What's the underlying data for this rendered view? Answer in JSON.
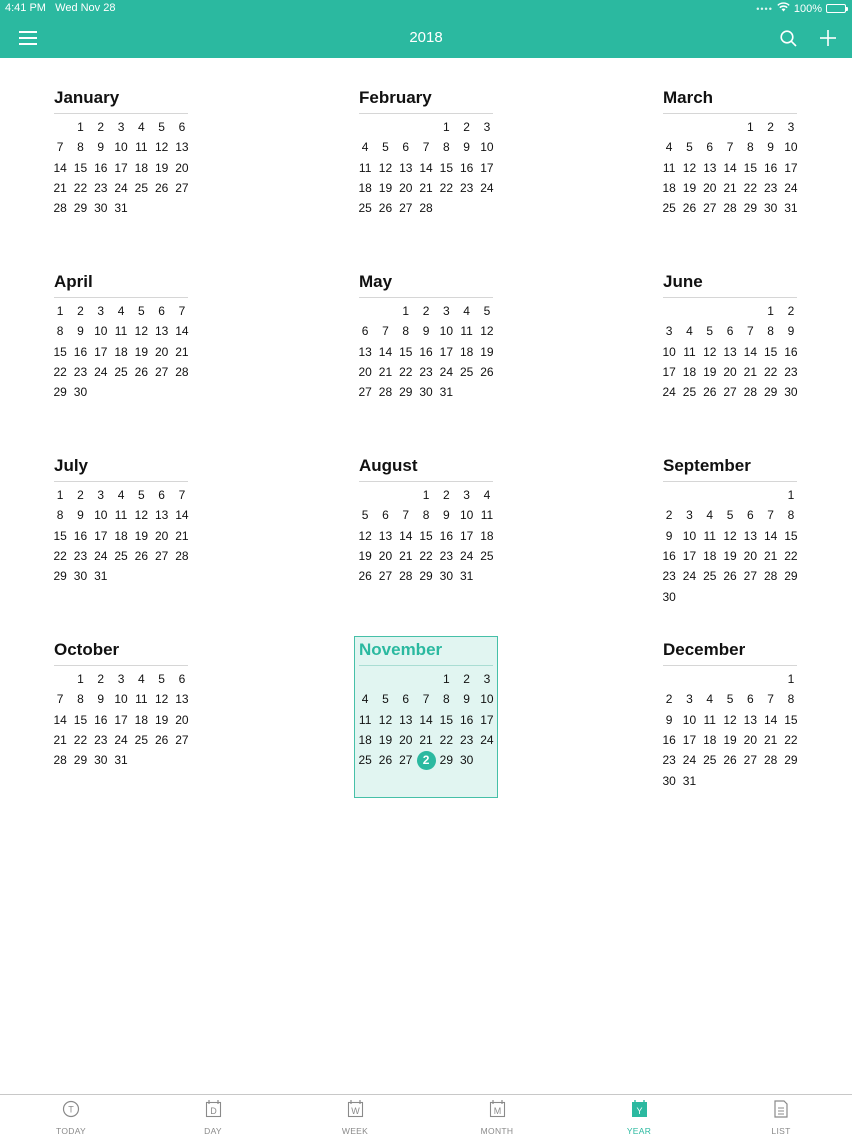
{
  "status": {
    "time": "4:41 PM",
    "date": "Wed Nov 28",
    "battery": "100%"
  },
  "header": {
    "title": "2018"
  },
  "colors": {
    "accent": "#2bb9a0",
    "selected_bg": "#e1f5f1"
  },
  "icons": {
    "menu": "hamburger-icon",
    "search": "search-icon",
    "add": "plus-icon"
  },
  "months": [
    {
      "name": "January",
      "rows": [
        [
          "",
          "1",
          "2",
          "3",
          "4",
          "5",
          "6"
        ],
        [
          "7",
          "8",
          "9",
          "10",
          "11",
          "12",
          "13"
        ],
        [
          "14",
          "15",
          "16",
          "17",
          "18",
          "19",
          "20"
        ],
        [
          "21",
          "22",
          "23",
          "24",
          "25",
          "26",
          "27"
        ],
        [
          "28",
          "29",
          "30",
          "31",
          "",
          "",
          ""
        ]
      ]
    },
    {
      "name": "February",
      "rows": [
        [
          "",
          "",
          "",
          "",
          "1",
          "2",
          "3"
        ],
        [
          "4",
          "5",
          "6",
          "7",
          "8",
          "9",
          "10"
        ],
        [
          "11",
          "12",
          "13",
          "14",
          "15",
          "16",
          "17"
        ],
        [
          "18",
          "19",
          "20",
          "21",
          "22",
          "23",
          "24"
        ],
        [
          "25",
          "26",
          "27",
          "28",
          "",
          "",
          ""
        ]
      ]
    },
    {
      "name": "March",
      "rows": [
        [
          "",
          "",
          "",
          "",
          "1",
          "2",
          "3"
        ],
        [
          "4",
          "5",
          "6",
          "7",
          "8",
          "9",
          "10"
        ],
        [
          "11",
          "12",
          "13",
          "14",
          "15",
          "16",
          "17"
        ],
        [
          "18",
          "19",
          "20",
          "21",
          "22",
          "23",
          "24"
        ],
        [
          "25",
          "26",
          "27",
          "28",
          "29",
          "30",
          "31"
        ]
      ]
    },
    {
      "name": "April",
      "rows": [
        [
          "1",
          "2",
          "3",
          "4",
          "5",
          "6",
          "7"
        ],
        [
          "8",
          "9",
          "10",
          "11",
          "12",
          "13",
          "14"
        ],
        [
          "15",
          "16",
          "17",
          "18",
          "19",
          "20",
          "21"
        ],
        [
          "22",
          "23",
          "24",
          "25",
          "26",
          "27",
          "28"
        ],
        [
          "29",
          "30",
          "",
          "",
          "",
          "",
          ""
        ]
      ]
    },
    {
      "name": "May",
      "rows": [
        [
          "",
          "",
          "1",
          "2",
          "3",
          "4",
          "5"
        ],
        [
          "6",
          "7",
          "8",
          "9",
          "10",
          "11",
          "12"
        ],
        [
          "13",
          "14",
          "15",
          "16",
          "17",
          "18",
          "19"
        ],
        [
          "20",
          "21",
          "22",
          "23",
          "24",
          "25",
          "26"
        ],
        [
          "27",
          "28",
          "29",
          "30",
          "31",
          "",
          ""
        ]
      ]
    },
    {
      "name": "June",
      "rows": [
        [
          "",
          "",
          "",
          "",
          "",
          "1",
          "2"
        ],
        [
          "3",
          "4",
          "5",
          "6",
          "7",
          "8",
          "9"
        ],
        [
          "10",
          "11",
          "12",
          "13",
          "14",
          "15",
          "16"
        ],
        [
          "17",
          "18",
          "19",
          "20",
          "21",
          "22",
          "23"
        ],
        [
          "24",
          "25",
          "26",
          "27",
          "28",
          "29",
          "30"
        ]
      ]
    },
    {
      "name": "July",
      "rows": [
        [
          "1",
          "2",
          "3",
          "4",
          "5",
          "6",
          "7"
        ],
        [
          "8",
          "9",
          "10",
          "11",
          "12",
          "13",
          "14"
        ],
        [
          "15",
          "16",
          "17",
          "18",
          "19",
          "20",
          "21"
        ],
        [
          "22",
          "23",
          "24",
          "25",
          "26",
          "27",
          "28"
        ],
        [
          "29",
          "30",
          "31",
          "",
          "",
          "",
          ""
        ]
      ]
    },
    {
      "name": "August",
      "rows": [
        [
          "",
          "",
          "",
          "1",
          "2",
          "3",
          "4"
        ],
        [
          "5",
          "6",
          "7",
          "8",
          "9",
          "10",
          "11"
        ],
        [
          "12",
          "13",
          "14",
          "15",
          "16",
          "17",
          "18"
        ],
        [
          "19",
          "20",
          "21",
          "22",
          "23",
          "24",
          "25"
        ],
        [
          "26",
          "27",
          "28",
          "29",
          "30",
          "31",
          ""
        ]
      ]
    },
    {
      "name": "September",
      "rows": [
        [
          "",
          "",
          "",
          "",
          "",
          "",
          "1"
        ],
        [
          "2",
          "3",
          "4",
          "5",
          "6",
          "7",
          "8"
        ],
        [
          "9",
          "10",
          "11",
          "12",
          "13",
          "14",
          "15"
        ],
        [
          "16",
          "17",
          "18",
          "19",
          "20",
          "21",
          "22"
        ],
        [
          "23",
          "24",
          "25",
          "26",
          "27",
          "28",
          "29"
        ],
        [
          "30",
          "",
          "",
          "",
          "",
          "",
          ""
        ]
      ]
    },
    {
      "name": "October",
      "rows": [
        [
          "",
          "1",
          "2",
          "3",
          "4",
          "5",
          "6"
        ],
        [
          "7",
          "8",
          "9",
          "10",
          "11",
          "12",
          "13"
        ],
        [
          "14",
          "15",
          "16",
          "17",
          "18",
          "19",
          "20"
        ],
        [
          "21",
          "22",
          "23",
          "24",
          "25",
          "26",
          "27"
        ],
        [
          "28",
          "29",
          "30",
          "31",
          "",
          "",
          ""
        ]
      ]
    },
    {
      "name": "November",
      "selected": true,
      "today": "2",
      "rows": [
        [
          "",
          "",
          "",
          "",
          "1",
          "2",
          "3"
        ],
        [
          "4",
          "5",
          "6",
          "7",
          "8",
          "9",
          "10"
        ],
        [
          "11",
          "12",
          "13",
          "14",
          "15",
          "16",
          "17"
        ],
        [
          "18",
          "19",
          "20",
          "21",
          "22",
          "23",
          "24"
        ],
        [
          "25",
          "26",
          "27",
          "2",
          "29",
          "30",
          ""
        ]
      ]
    },
    {
      "name": "December",
      "rows": [
        [
          "",
          "",
          "",
          "",
          "",
          "",
          "1"
        ],
        [
          "2",
          "3",
          "4",
          "5",
          "6",
          "7",
          "8"
        ],
        [
          "9",
          "10",
          "11",
          "12",
          "13",
          "14",
          "15"
        ],
        [
          "16",
          "17",
          "18",
          "19",
          "20",
          "21",
          "22"
        ],
        [
          "23",
          "24",
          "25",
          "26",
          "27",
          "28",
          "29"
        ],
        [
          "30",
          "31",
          "",
          "",
          "",
          "",
          ""
        ]
      ]
    }
  ],
  "tabs": [
    {
      "label": "TODAY",
      "glyph": "T",
      "icon": "today-icon",
      "active": false
    },
    {
      "label": "DAY",
      "glyph": "D",
      "icon": "day-icon",
      "active": false
    },
    {
      "label": "WEEK",
      "glyph": "W",
      "icon": "week-icon",
      "active": false
    },
    {
      "label": "MONTH",
      "glyph": "M",
      "icon": "month-icon",
      "active": false
    },
    {
      "label": "YEAR",
      "glyph": "Y",
      "icon": "year-icon",
      "active": true
    },
    {
      "label": "LIST",
      "glyph": "",
      "icon": "list-icon",
      "active": false
    }
  ]
}
